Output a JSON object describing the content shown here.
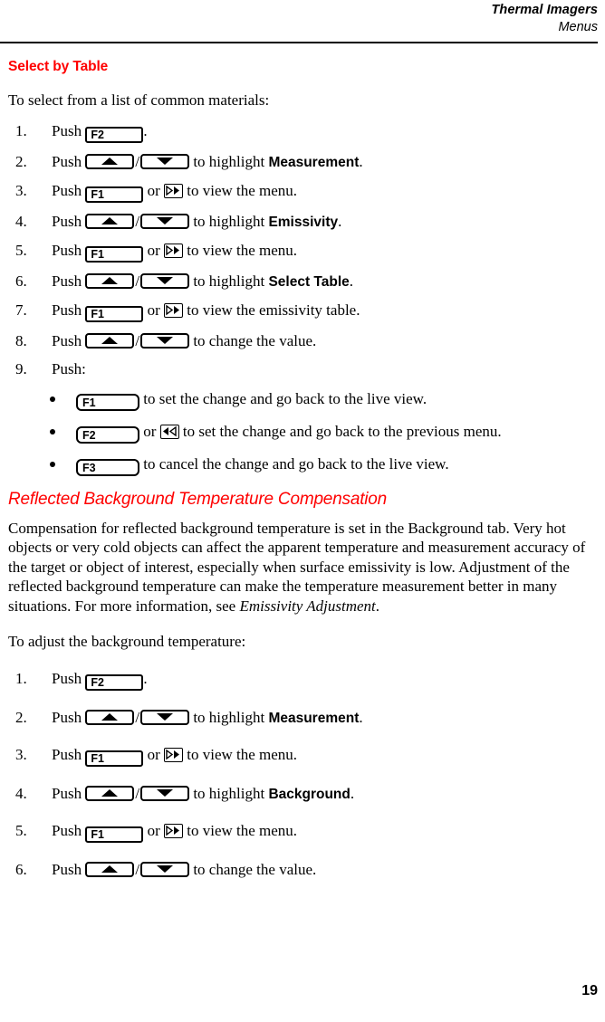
{
  "header": {
    "title": "Thermal Imagers",
    "subtitle": "Menus"
  },
  "section1": {
    "heading": "Select by Table",
    "lead": "To select from a list of common materials:",
    "steps": [
      {
        "num": "1.",
        "pre": "Push",
        "keys": [
          "F2"
        ],
        "post": "."
      },
      {
        "num": "2.",
        "pre": "Push",
        "keys": [
          "up",
          "down"
        ],
        "mid": "to highlight",
        "bold": "Measurement",
        "post": "."
      },
      {
        "num": "3.",
        "pre": "Push",
        "keys": [
          "F1"
        ],
        "or": "or",
        "navkey": "right",
        "post": "to view the menu."
      },
      {
        "num": "4.",
        "pre": "Push",
        "keys": [
          "up",
          "down"
        ],
        "mid": "to highlight",
        "bold": "Emissivity",
        "post": "."
      },
      {
        "num": "5.",
        "pre": "Push",
        "keys": [
          "F1"
        ],
        "or": "or",
        "navkey": "right",
        "post": "to view the menu."
      },
      {
        "num": "6.",
        "pre": "Push",
        "keys": [
          "up",
          "down"
        ],
        "mid": "to highlight",
        "bold": "Select Table",
        "post": "."
      },
      {
        "num": "7.",
        "pre": "Push",
        "keys": [
          "F1"
        ],
        "or": "or",
        "navkey": "right",
        "post": "to view the emissivity table."
      },
      {
        "num": "8.",
        "pre": "Push",
        "keys": [
          "up",
          "down"
        ],
        "mid": "to change the value.",
        "post": ""
      },
      {
        "num": "9.",
        "pre": "Push:",
        "keys": []
      }
    ],
    "sublist": [
      {
        "key": "F1",
        "text": "to set the change and go back to the live view."
      },
      {
        "key": "F2",
        "or": "or",
        "navkey": "left",
        "text": "to set the change and go back to the previous menu."
      },
      {
        "key": "F3",
        "text": "to cancel the change and go back to the live view."
      }
    ]
  },
  "section2": {
    "heading": "Reflected Background Temperature Compensation",
    "paragraph_a": "Compensation for reflected background temperature is set in the Background tab. Very hot objects or very cold objects can affect the apparent temperature and measurement accuracy of the target or object of interest, especially when surface emissivity is low. Adjustment of the reflected background temperature can make the temperature measurement better in many situations. For more information, see ",
    "paragraph_a_italic": "Emissivity Adjustment",
    "paragraph_a_end": ".",
    "lead": "To adjust the background temperature:",
    "steps": [
      {
        "num": "1.",
        "pre": "Push",
        "keys": [
          "F2"
        ],
        "post": "."
      },
      {
        "num": "2.",
        "pre": "Push",
        "keys": [
          "up",
          "down"
        ],
        "mid": "to highlight",
        "bold": "Measurement",
        "post": "."
      },
      {
        "num": "3.",
        "pre": "Push",
        "keys": [
          "F1"
        ],
        "or": "or",
        "navkey": "right",
        "post": "to view the menu."
      },
      {
        "num": "4.",
        "pre": "Push",
        "keys": [
          "up",
          "down"
        ],
        "mid": "to highlight",
        "bold": "Background",
        "post": "."
      },
      {
        "num": "5.",
        "pre": "Push",
        "keys": [
          "F1"
        ],
        "or": "or",
        "navkey": "right",
        "post": "to view the menu."
      },
      {
        "num": "6.",
        "pre": "Push",
        "keys": [
          "up",
          "down"
        ],
        "mid": "to change the value.",
        "post": ""
      }
    ]
  },
  "footer": {
    "page_number": "19"
  },
  "colors": {
    "heading_red": "#ff0000",
    "text_black": "#000000"
  }
}
